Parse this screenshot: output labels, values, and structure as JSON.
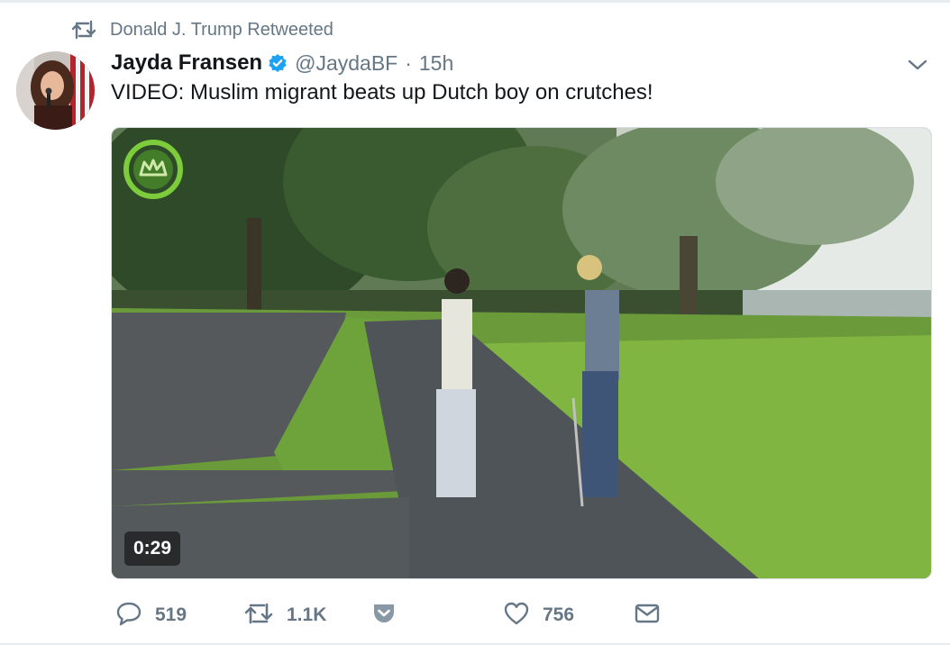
{
  "retweet_context": {
    "label": "Donald J. Trump Retweeted",
    "icon": "retweet-icon"
  },
  "tweet": {
    "author": {
      "display_name": "Jayda Fransen",
      "handle": "@JaydaBF",
      "verified": true,
      "avatar": "avatar-photo"
    },
    "separator": "·",
    "time": "15h",
    "text": "VIDEO: Muslim migrant beats up Dutch boy on crutches!",
    "media": {
      "type": "video",
      "duration": "0:29"
    }
  },
  "actions": {
    "reply": {
      "icon": "reply-icon",
      "count": "519"
    },
    "retweet": {
      "icon": "retweet-icon",
      "count": "1.1K"
    },
    "save": {
      "icon": "pocket-icon"
    },
    "like": {
      "icon": "heart-icon",
      "count": "756"
    },
    "dm": {
      "icon": "envelope-icon"
    }
  },
  "colors": {
    "primary_text": "#14171a",
    "secondary_text": "#657786",
    "verified_blue": "#1da1f2",
    "divider": "#e6ecf0"
  }
}
